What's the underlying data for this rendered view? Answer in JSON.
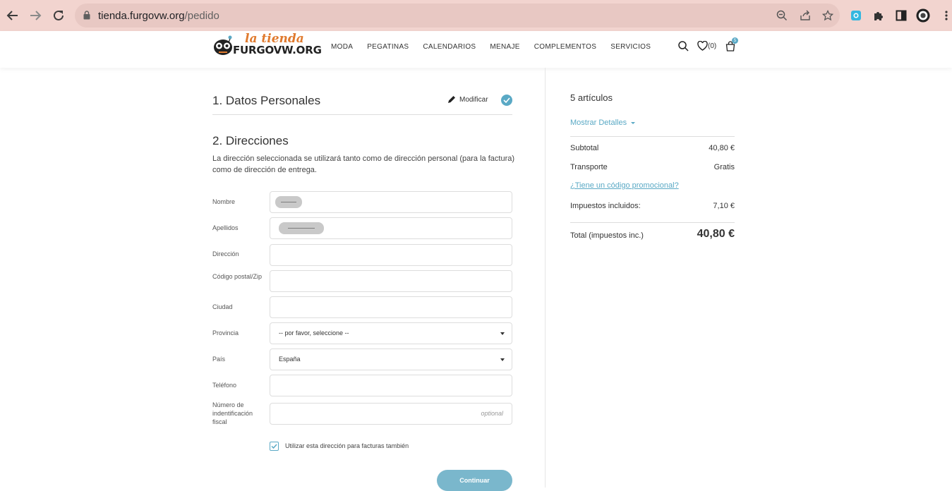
{
  "browser": {
    "url_host": "tienda.furgovw.org",
    "url_path": "/pedido"
  },
  "header": {
    "logo_tagline": "la tienda",
    "logo_brand": "FURGOVW.ORG",
    "nav": [
      "MODA",
      "PEGATINAS",
      "CALENDARIOS",
      "MENAJE",
      "COMPLEMENTOS",
      "SERVICIOS"
    ],
    "wishlist_count": "(0)",
    "cart_count": "5"
  },
  "checkout": {
    "step1_title": "1. Datos Personales",
    "modify_label": "Modificar",
    "step2_title": "2. Direcciones",
    "description": "La dirección seleccionada se utilizará tanto como de dirección personal (para la factura) como de dirección de entrega.",
    "fields": [
      {
        "label": "Nombre",
        "value": ""
      },
      {
        "label": "Apellidos",
        "value": ""
      },
      {
        "label": "Dirección",
        "value": ""
      },
      {
        "label": "Código postal/Zip",
        "value": ""
      },
      {
        "label": "Ciudad",
        "value": ""
      },
      {
        "label": "Provincia",
        "value": "-- por favor, seleccione --"
      },
      {
        "label": "País",
        "value": "España"
      },
      {
        "label": "Teléfono",
        "value": ""
      },
      {
        "label": "Número de indentificación fiscal",
        "placeholder": "optional"
      }
    ],
    "billing_checkbox_label": "Utilizar esta dirección para facturas también",
    "billing_checked": true,
    "continue_label": "Continuar"
  },
  "summary": {
    "items_title": "5 artículos",
    "details_label": "Mostrar Detalles",
    "subtotal_label": "Subtotal",
    "subtotal_value": "40,80 €",
    "shipping_label": "Transporte",
    "shipping_value": "Gratis",
    "promo_label": "¿Tiene un código promocional?",
    "taxes_label": "Impuestos incluidos:",
    "taxes_value": "7,10 €",
    "total_label": "Total (impuestos inc.)",
    "total_value": "40,80 €"
  },
  "colors": {
    "accent": "#5aa9c5",
    "button": "#7ab7cc",
    "chrome": "#f2d4cf",
    "logo_orange": "#e07a2e"
  }
}
